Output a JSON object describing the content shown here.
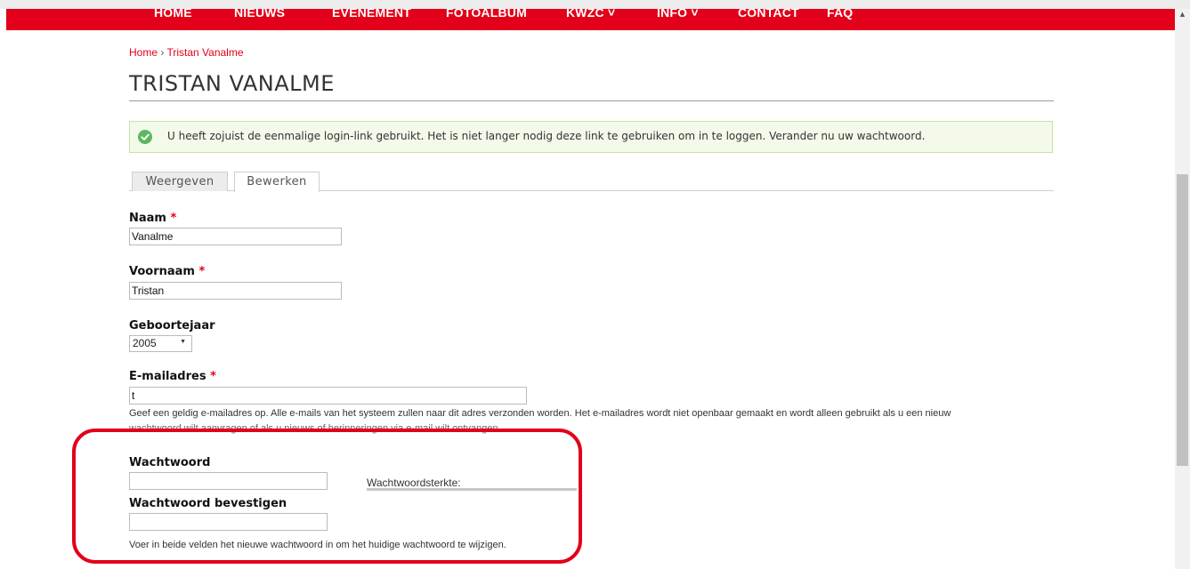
{
  "nav": {
    "items": [
      {
        "label": "HOME"
      },
      {
        "label": "NIEUWS"
      },
      {
        "label": "EVENEMENT"
      },
      {
        "label": "FOTOALBUM"
      },
      {
        "label": "KWZC ˅"
      },
      {
        "label": "INFO ˅"
      },
      {
        "label": "CONTACT"
      },
      {
        "label": "FAQ"
      }
    ],
    "bg_color": "#e2001a"
  },
  "breadcrumb": {
    "home": "Home",
    "separator": "›",
    "current": "Tristan Vanalme"
  },
  "page": {
    "title": "TRISTAN VANALME"
  },
  "status_message": {
    "icon": "check-circle-icon",
    "text": "U heeft zojuist de eenmalige login-link gebruikt. Het is niet langer nodig deze link te gebruiken om in te loggen. Verander nu uw wachtwoord."
  },
  "tabs": [
    {
      "label": "Weergeven",
      "active": false
    },
    {
      "label": "Bewerken",
      "active": true
    }
  ],
  "form": {
    "naam": {
      "label": "Naam",
      "required": "*",
      "value": "Vanalme"
    },
    "voornaam": {
      "label": "Voornaam",
      "required": "*",
      "value": "Tristan"
    },
    "geboortejaar": {
      "label": "Geboortejaar",
      "value": "2005"
    },
    "email": {
      "label": "E-mailadres",
      "required": "*",
      "value": "t",
      "description": "Geef een geldig e-mailadres op. Alle e-mails van het systeem zullen naar dit adres verzonden worden. Het e-mailadres wordt niet openbaar gemaakt en wordt alleen gebruikt als u een nieuw",
      "description_line2": "wachtwoord wilt aanvragen of als u nieuws of herinneringen via e-mail wilt ontvangen."
    },
    "wachtwoord": {
      "label": "Wachtwoord",
      "value": ""
    },
    "strength_label": "Wachtwoordsterkte:",
    "wachtwoord_bevestigen": {
      "label": "Wachtwoord bevestigen",
      "value": ""
    },
    "password_description": "Voer in beide velden het nieuwe wachtwoord in om het huidige wachtwoord te wijzigen."
  },
  "colors": {
    "accent": "#e2001a",
    "success_bg": "#f3fae9",
    "success_icon": "#5cb85c"
  }
}
